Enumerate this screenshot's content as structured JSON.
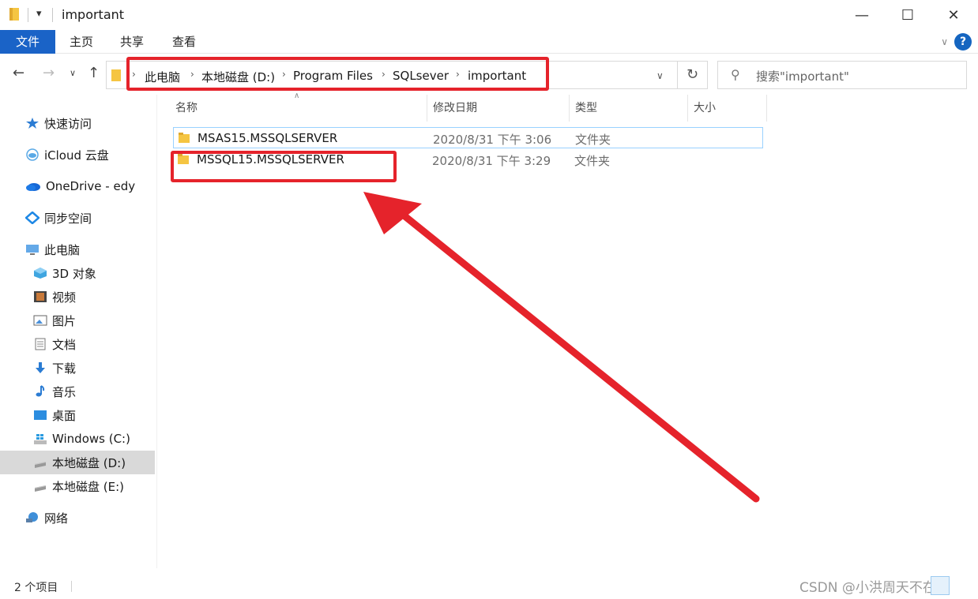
{
  "window": {
    "title": "important",
    "quick_access_arrow": "▾",
    "minimize": "—",
    "maximize": "☐",
    "close": "✕"
  },
  "ribbon": {
    "tabs": [
      {
        "label": "文件",
        "active": true
      },
      {
        "label": "主页",
        "active": false
      },
      {
        "label": "共享",
        "active": false
      },
      {
        "label": "查看",
        "active": false
      }
    ],
    "help": "?"
  },
  "address": {
    "breadcrumbs": [
      "此电脑",
      "本地磁盘 (D:)",
      "Program Files",
      "SQLsever",
      "important"
    ],
    "search_placeholder": "搜索\"important\""
  },
  "sidebar": {
    "items": [
      {
        "label": "快速访问",
        "icon": "star-icon"
      },
      {
        "label": "iCloud 云盘",
        "icon": "icloud-icon"
      },
      {
        "label": "OneDrive - edy",
        "icon": "onedrive-icon"
      },
      {
        "label": "同步空间",
        "icon": "sync-space-icon"
      },
      {
        "label": "此电脑",
        "icon": "computer-icon"
      },
      {
        "label": "3D 对象",
        "icon": "3d-objects-icon"
      },
      {
        "label": "视频",
        "icon": "video-icon"
      },
      {
        "label": "图片",
        "icon": "pictures-icon"
      },
      {
        "label": "文档",
        "icon": "documents-icon"
      },
      {
        "label": "下载",
        "icon": "download-icon"
      },
      {
        "label": "音乐",
        "icon": "music-icon"
      },
      {
        "label": "桌面",
        "icon": "desktop-icon"
      },
      {
        "label": "Windows (C:)",
        "icon": "windows-drive-icon"
      },
      {
        "label": "本地磁盘 (D:)",
        "icon": "drive-icon",
        "selected": true
      },
      {
        "label": "本地磁盘 (E:)",
        "icon": "drive-icon"
      },
      {
        "label": "网络",
        "icon": "network-icon"
      }
    ]
  },
  "columns": {
    "name": "名称",
    "modified": "修改日期",
    "type": "类型",
    "size": "大小"
  },
  "files": [
    {
      "name": "MSAS15.MSSQLSERVER",
      "modified": "2020/8/31 下午 3:06",
      "type": "文件夹",
      "size": ""
    },
    {
      "name": "MSSQL15.MSSQLSERVER",
      "modified": "2020/8/31 下午 3:29",
      "type": "文件夹",
      "size": ""
    }
  ],
  "status": {
    "item_count": "2 个项目",
    "watermark": "CSDN @小洪周天不在家"
  },
  "colors": {
    "accent": "#1a63c7",
    "annotation_red": "#e5232b",
    "selection_border": "#99d1ff",
    "folder": "#f5c542"
  }
}
